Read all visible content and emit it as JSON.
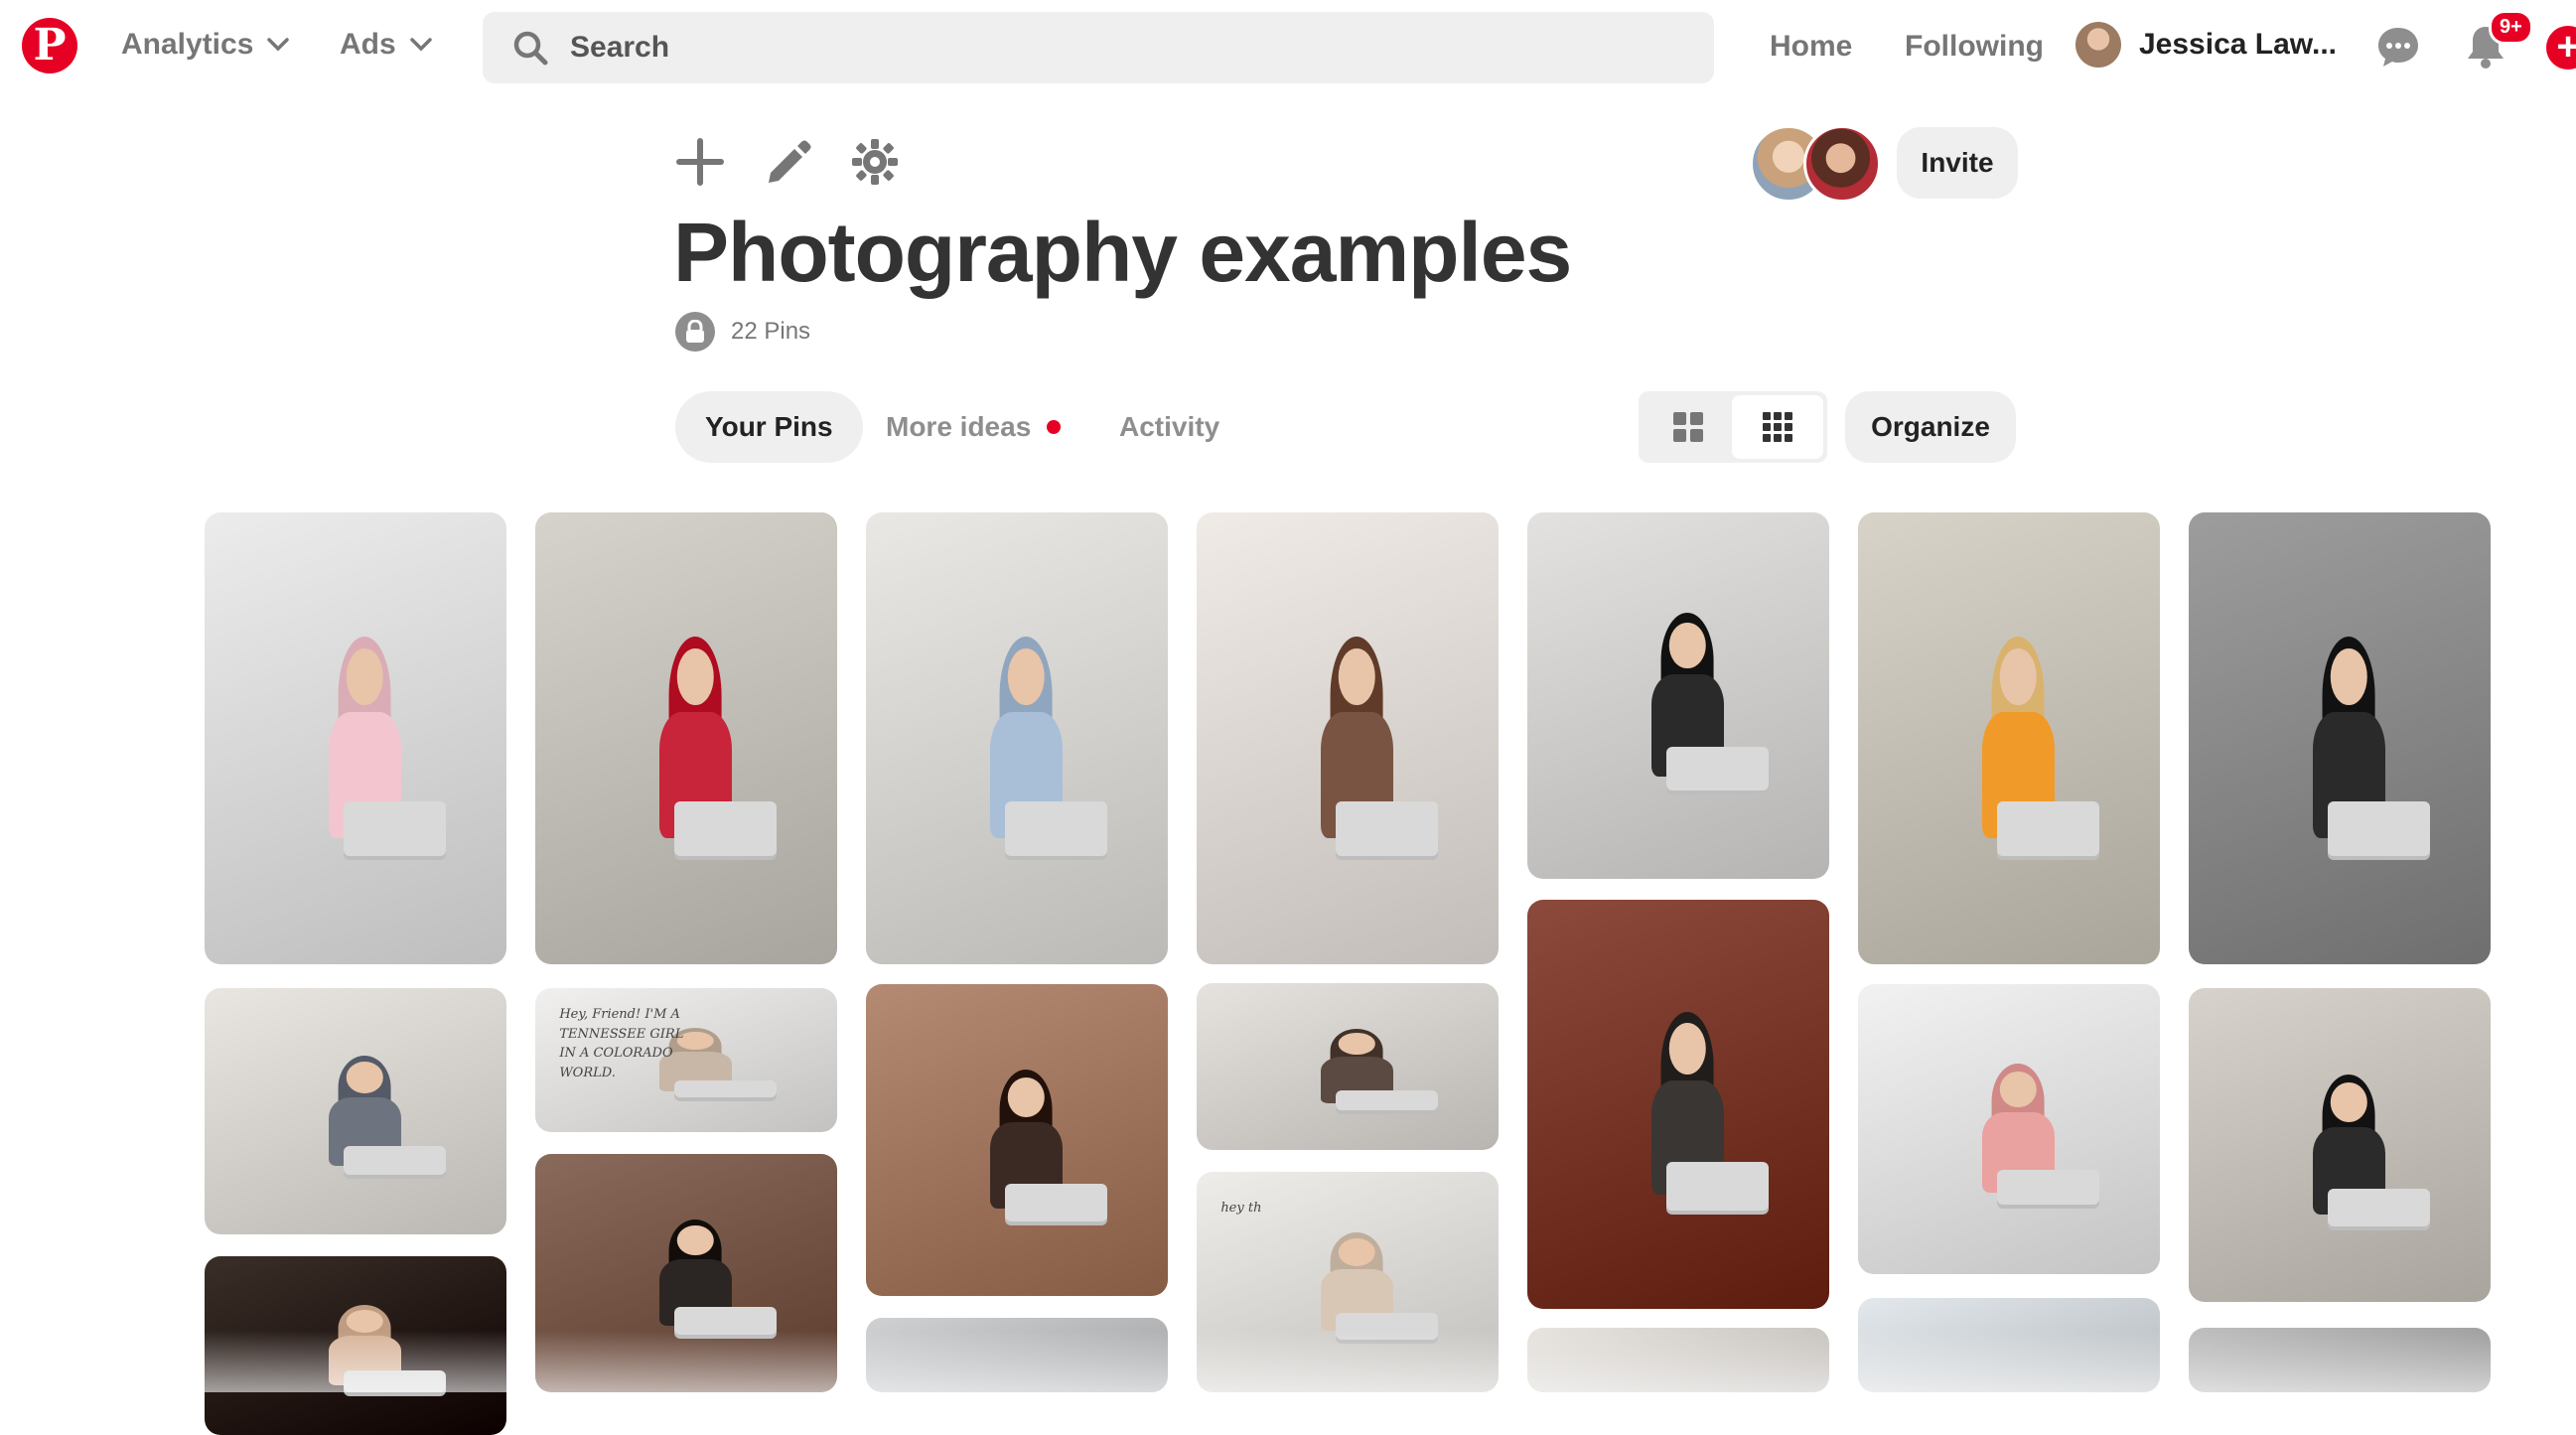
{
  "topbar": {
    "logo_letter": "P",
    "nav": [
      {
        "label": "Analytics"
      },
      {
        "label": "Ads"
      }
    ],
    "search_placeholder": "Search",
    "links": [
      {
        "label": "Home"
      },
      {
        "label": "Following"
      }
    ],
    "user_name": "Jessica Law...",
    "notifications_badge": "9+",
    "icons": [
      "pinterest-logo",
      "chevron-down-icon",
      "search-icon",
      "messages-icon",
      "bell-icon",
      "plus-icon"
    ]
  },
  "board": {
    "tools": [
      "plus-icon",
      "pencil-icon",
      "gear-icon"
    ],
    "invite_label": "Invite",
    "title": "Photography examples",
    "pin_count": "22 Pins",
    "secret": true,
    "tabs": [
      {
        "label": "Your Pins",
        "active": true
      },
      {
        "label": "More ideas",
        "new": true
      },
      {
        "label": "Activity"
      }
    ],
    "view_mode": "compact-grid",
    "organize_label": "Organize"
  },
  "pins": {
    "columns": [
      [
        {
          "bg": "#ececec",
          "scene": "laptop-desk-topview",
          "accent": "#f3c6cf"
        },
        {
          "bg": "#e9e6e1",
          "scene": "office-with-surfboard",
          "accent": "#6d7480"
        },
        {
          "bg": "#3a2f28",
          "scene": "woman-laptop-cafe",
          "accent": "#d8b49a"
        }
      ],
      [
        {
          "bg": "#d6d2cc",
          "scene": "laptop-flowers-desk",
          "accent": "#c8243a"
        },
        {
          "bg": "#f1f0ee",
          "scene": "text-overlay-woman",
          "accent": "#c8b7a6",
          "text": "Hey, Friend! I'M A TENNESSEE GIRL IN A COLORADO WORLD."
        },
        {
          "bg": "#8a6a5b",
          "scene": "street-portrait",
          "accent": "#2b2624"
        }
      ],
      [
        {
          "bg": "#e9e8e4",
          "scene": "woman-at-desk-window",
          "accent": "#a9bfd8"
        },
        {
          "bg": "#b58a73",
          "scene": "woman-with-mug",
          "accent": "#3b2a24"
        },
        {
          "bg": "#cfd1d3",
          "scene": "desk-shelf",
          "accent": "#6b7d90"
        }
      ],
      [
        {
          "bg": "#f0ebe6",
          "scene": "living-room-gallery-wall",
          "accent": "#7a5443"
        },
        {
          "bg": "#e6e3df",
          "scene": "woman-bookshelf-laptop",
          "accent": "#5b4a42"
        },
        {
          "bg": "#efede9",
          "scene": "woman-laughing-floor",
          "accent": "#d9c7b5",
          "text": "hey th"
        }
      ],
      [
        {
          "bg": "#e4e2e0",
          "scene": "woman-bed-camera",
          "accent": "#2a2a2a"
        },
        {
          "bg": "#8b4a3c",
          "scene": "woman-chair-brick",
          "accent": "#3a3633"
        },
        {
          "bg": "#e8e4df",
          "scene": "woman-portrait",
          "accent": "#6a4a3c"
        }
      ],
      [
        {
          "bg": "#d8d3c8",
          "scene": "woman-table-oranges",
          "accent": "#f09a2a"
        },
        {
          "bg": "#f2f2f2",
          "scene": "woman-laptop-floral",
          "accent": "#e9a2a0"
        },
        {
          "bg": "#e3e8ec",
          "scene": "woman-window-room",
          "accent": "#5a6d7d"
        }
      ],
      [
        {
          "bg": "#9d9d9d",
          "scene": "woman-floor-laptop-bw",
          "accent": "#2a2a2a"
        },
        {
          "bg": "#d7d2cb",
          "scene": "woman-sofa-laptop",
          "accent": "#2b2b2b"
        },
        {
          "bg": "#bfbfbf",
          "scene": "partial",
          "accent": "#a5a5a5"
        }
      ]
    ]
  }
}
